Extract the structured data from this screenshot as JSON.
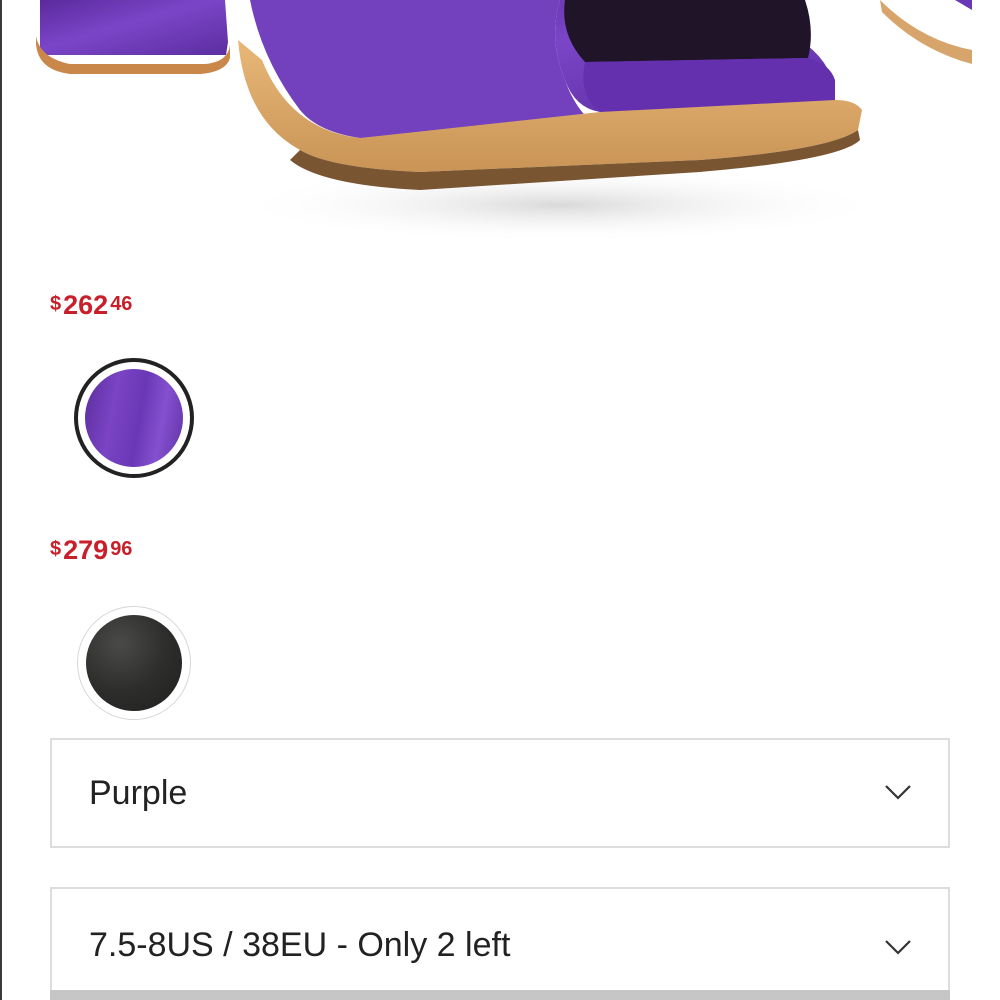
{
  "product": {
    "image_icon": "purple-heeled-sandal-image"
  },
  "color_options": [
    {
      "price": {
        "currency": "$",
        "dollars": "262",
        "cents": "46"
      },
      "swatch_color": "#6a38b6",
      "selected": true
    },
    {
      "price": {
        "currency": "$",
        "dollars": "279",
        "cents": "96"
      },
      "swatch_color": "#2e2e2d",
      "selected": false
    }
  ],
  "selectors": {
    "color": {
      "value": "Purple",
      "icon": "chevron-down-icon"
    },
    "size": {
      "value": "7.5-8US / 38EU  - Only 2 left",
      "icon": "chevron-down-icon"
    }
  },
  "colors": {
    "price_red": "#c8202a",
    "border_grey": "#dddddd",
    "text_dark": "#222222"
  }
}
